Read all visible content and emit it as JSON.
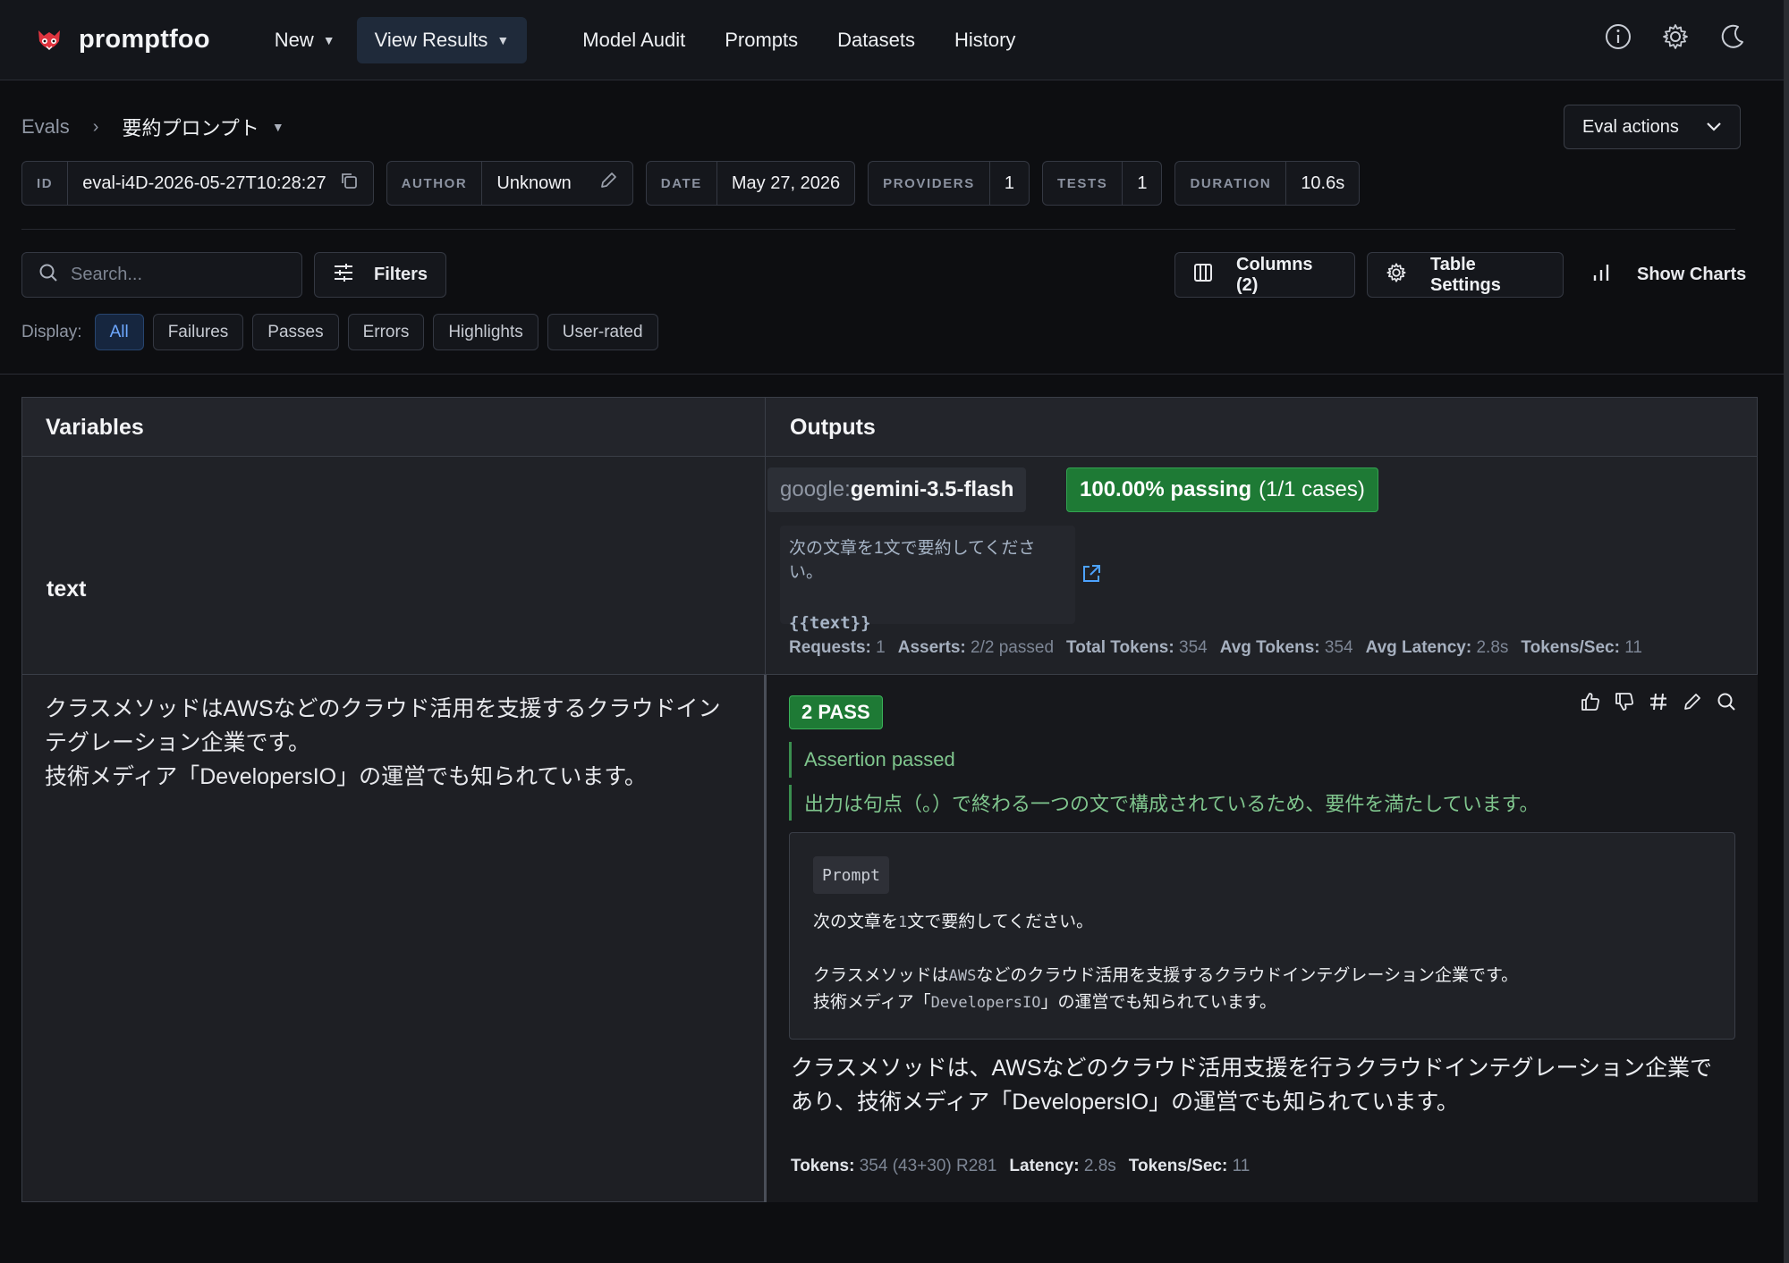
{
  "brand": {
    "name": "promptfoo"
  },
  "nav": {
    "items": [
      {
        "label": "New",
        "dropdown": true,
        "active": false
      },
      {
        "label": "View Results",
        "dropdown": true,
        "active": true
      },
      {
        "label": "Model Audit",
        "dropdown": false,
        "active": false
      },
      {
        "label": "Prompts",
        "dropdown": false,
        "active": false
      },
      {
        "label": "Datasets",
        "dropdown": false,
        "active": false
      },
      {
        "label": "History",
        "dropdown": false,
        "active": false
      }
    ],
    "right_icons": [
      "info-icon",
      "gear-icon",
      "moon-icon"
    ]
  },
  "breadcrumb": {
    "root": "Evals",
    "current": "要約プロンプト"
  },
  "eval_actions": {
    "label": "Eval actions"
  },
  "meta": {
    "id": {
      "label": "ID",
      "value": "eval-i4D-2026-05-27T10:28:27"
    },
    "author": {
      "label": "AUTHOR",
      "value": "Unknown"
    },
    "date": {
      "label": "DATE",
      "value": "May 27, 2026"
    },
    "providers": {
      "label": "PROVIDERS",
      "value": "1"
    },
    "tests": {
      "label": "TESTS",
      "value": "1"
    },
    "duration": {
      "label": "DURATION",
      "value": "10.6s"
    }
  },
  "toolbar": {
    "search_placeholder": "Search...",
    "filters_label": "Filters",
    "columns_label": "Columns (2)",
    "table_settings_label": "Table Settings",
    "show_charts_label": "Show Charts"
  },
  "display": {
    "label": "Display:",
    "options": [
      "All",
      "Failures",
      "Passes",
      "Errors",
      "Highlights",
      "User-rated"
    ],
    "active": "All"
  },
  "table": {
    "headers": {
      "variables": "Variables",
      "outputs": "Outputs"
    },
    "variable_name": "text",
    "provider": {
      "prefix": "google:",
      "model": "gemini-3.5-flash"
    },
    "passing": {
      "main": "100.00% passing",
      "sub": "(1/1 cases)"
    },
    "prompt_preview": {
      "line1": "次の文章を1文で要約してください。",
      "line2": "{{text}}"
    },
    "stats": [
      {
        "k": "Requests:",
        "v": "1"
      },
      {
        "k": "Asserts:",
        "v": "2/2 passed"
      },
      {
        "k": "Total Tokens:",
        "v": "354"
      },
      {
        "k": "Avg Tokens:",
        "v": "354"
      },
      {
        "k": "Avg Latency:",
        "v": "2.8s"
      },
      {
        "k": "Tokens/Sec:",
        "v": "11"
      }
    ],
    "variable_value": {
      "line1": "クラスメソッドはAWSなどのクラウド活用を支援するクラウドインテグレーション企業です。",
      "line2": "技術メディア「DevelopersIO」の運営でも知られています。"
    },
    "result": {
      "pass_badge": "2 PASS",
      "assertion_1": "Assertion passed",
      "assertion_2": "出力は句点（。）で終わる一つの文で構成されているため、要件を満たしています。",
      "prompt_tag": "Prompt",
      "prompt_line1a": "次の文章を",
      "prompt_line1b": "1",
      "prompt_line1c": "文で要約してください。",
      "prompt_line2a": "クラスメソッドは",
      "prompt_line2b": "AWS",
      "prompt_line2c": "などのクラウド活用を支援するクラウドインテグレーション企業です。",
      "prompt_line3a": "技術メディア「",
      "prompt_line3b": "DevelopersIO",
      "prompt_line3c": "」の運営でも知られています。",
      "output": "クラスメソッドは、AWSなどのクラウド活用支援を行うクラウドインテグレーション企業であり、技術メディア「DevelopersIO」の運営でも知られています。",
      "stats": [
        {
          "k": "Tokens:",
          "v": "354 (43+30) R281"
        },
        {
          "k": "Latency:",
          "v": "2.8s"
        },
        {
          "k": "Tokens/Sec:",
          "v": "11"
        }
      ]
    }
  },
  "colors": {
    "accent_blue": "#6ea8ff",
    "pass_green": "#1e7a35",
    "assert_green": "#7fc58d"
  }
}
